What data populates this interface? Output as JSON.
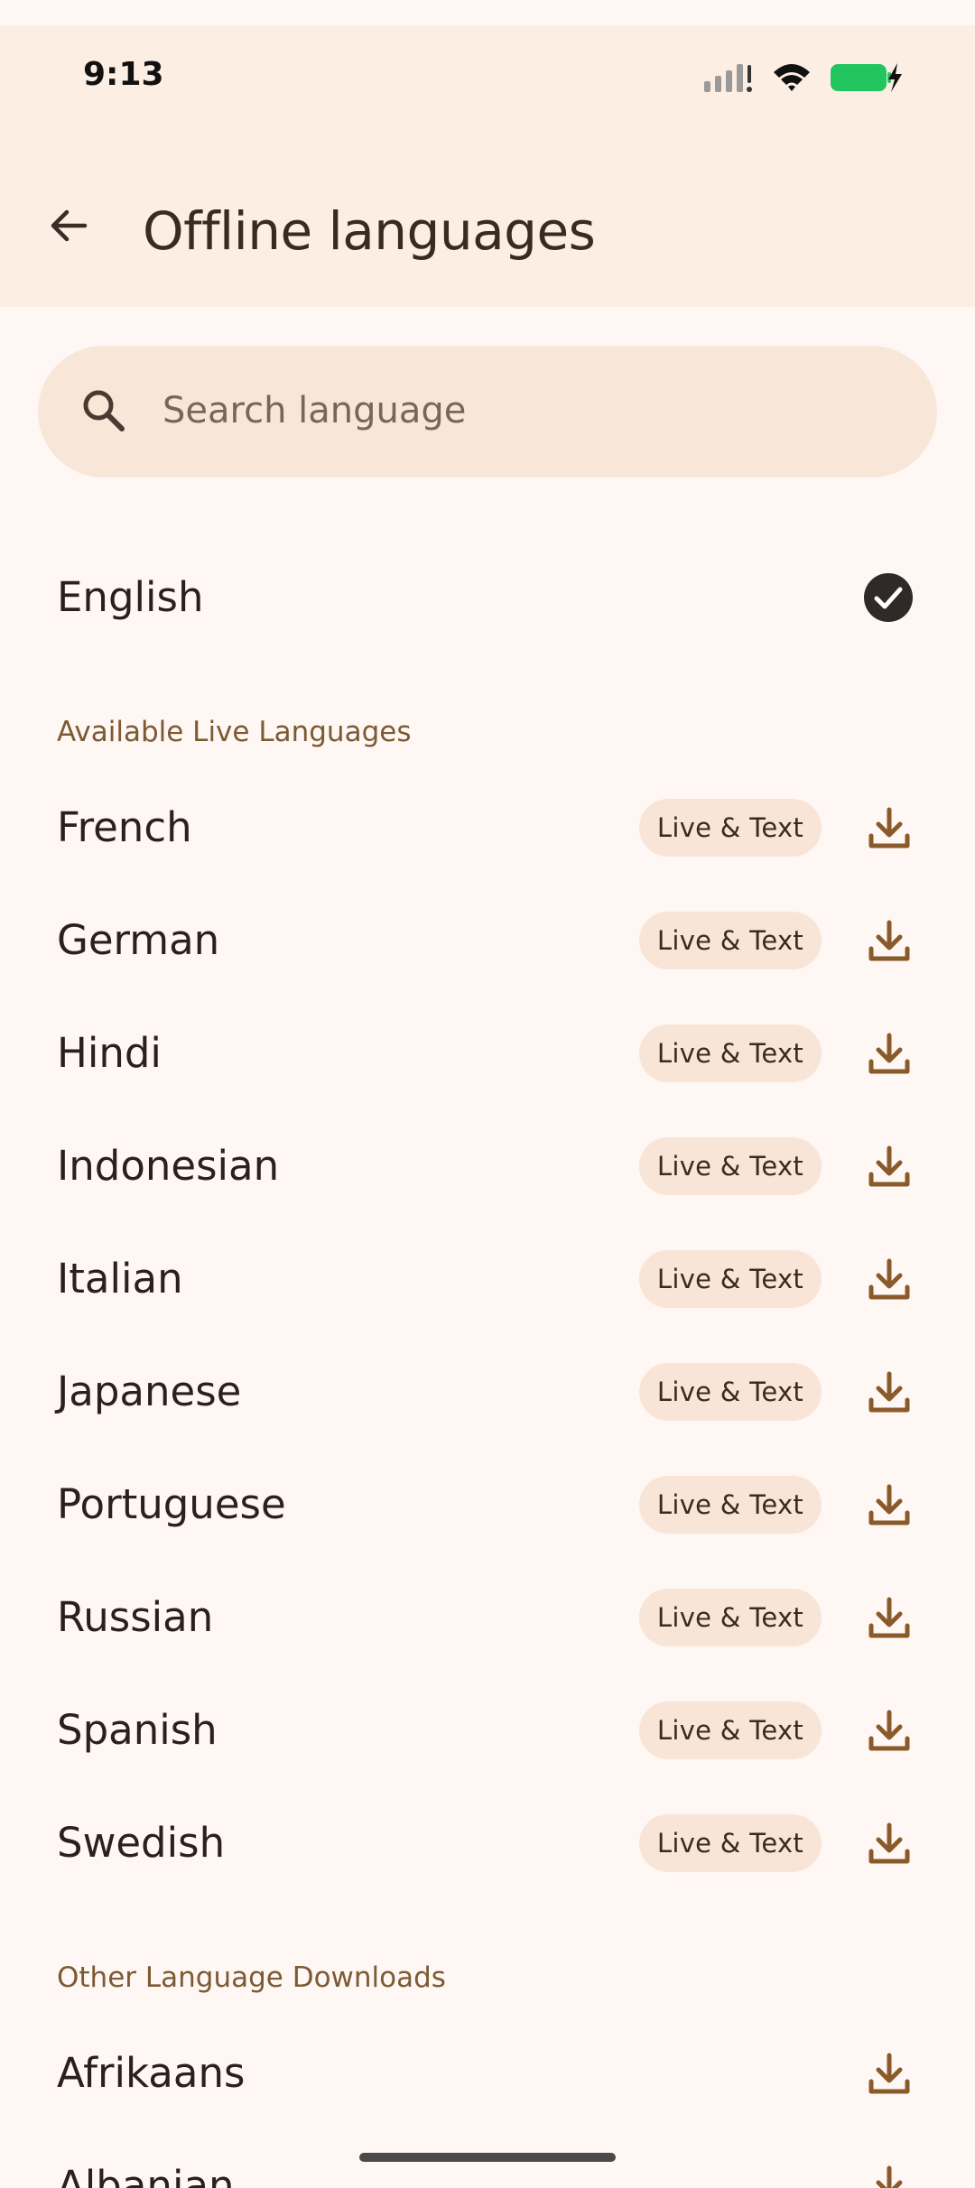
{
  "status_bar": {
    "time": "9:13"
  },
  "header": {
    "title": "Offline languages"
  },
  "search": {
    "placeholder": "Search language"
  },
  "installed": [
    {
      "name": "English"
    }
  ],
  "sections": {
    "live_title": "Available Live Languages",
    "other_title": "Other Language Downloads"
  },
  "live_languages": [
    {
      "name": "French",
      "badge": "Live & Text"
    },
    {
      "name": "German",
      "badge": "Live & Text"
    },
    {
      "name": "Hindi",
      "badge": "Live & Text"
    },
    {
      "name": "Indonesian",
      "badge": "Live & Text"
    },
    {
      "name": "Italian",
      "badge": "Live & Text"
    },
    {
      "name": "Japanese",
      "badge": "Live & Text"
    },
    {
      "name": "Portuguese",
      "badge": "Live & Text"
    },
    {
      "name": "Russian",
      "badge": "Live & Text"
    },
    {
      "name": "Spanish",
      "badge": "Live & Text"
    },
    {
      "name": "Swedish",
      "badge": "Live & Text"
    }
  ],
  "other_languages": [
    {
      "name": "Afrikaans"
    },
    {
      "name": "Albanian"
    }
  ],
  "icons": {
    "back": "arrow-back-icon",
    "search": "search-icon",
    "installed": "check-circle-icon",
    "download": "download-icon"
  },
  "colors": {
    "header_bg": "#fdeee4",
    "page_bg": "#fff7f3",
    "search_bg": "#f8e6d9",
    "badge_bg": "#f8e5d8",
    "accent_brown": "#8a5a2b",
    "section_title": "#7b5a34",
    "battery_green": "#22c55e"
  }
}
